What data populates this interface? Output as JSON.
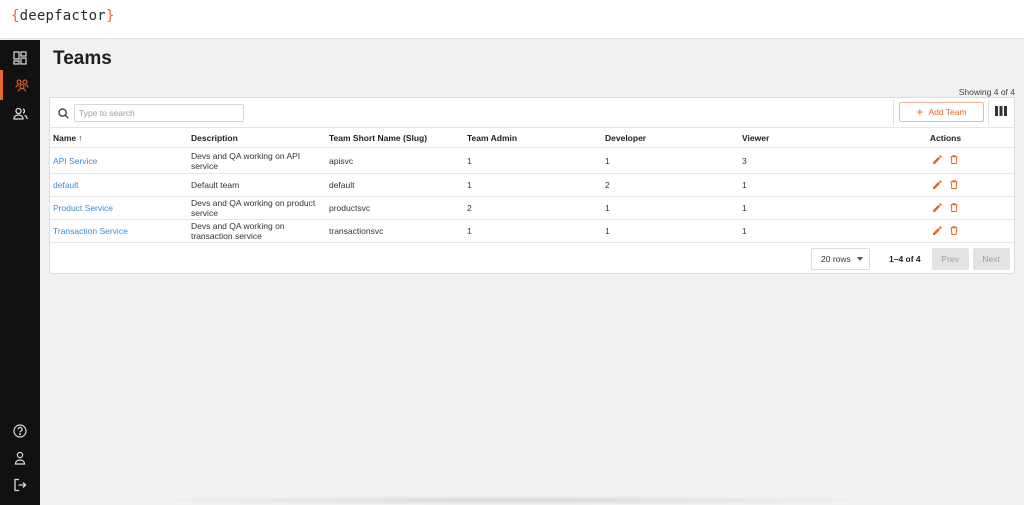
{
  "app": {
    "logo_open": "{",
    "logo_text": "deepfactor",
    "logo_close": "}"
  },
  "colors": {
    "accent": "#e8672c",
    "link": "#3a8bd8",
    "sidebar_bg": "#111111"
  },
  "sidebar": {
    "top_items": [
      {
        "icon": "dashboard-icon",
        "active": false
      },
      {
        "icon": "teams-icon",
        "active": true
      },
      {
        "icon": "users-icon",
        "active": false
      }
    ],
    "bottom_items": [
      {
        "icon": "help-icon"
      },
      {
        "icon": "profile-icon"
      },
      {
        "icon": "logout-icon"
      }
    ]
  },
  "page": {
    "title": "Teams",
    "showing": "Showing 4 of 4"
  },
  "toolbar": {
    "search_placeholder": "Type to search",
    "add_team_label": "Add Team",
    "columns_icon": "columns-icon"
  },
  "table": {
    "headers": {
      "name": "Name",
      "name_sort": "↑",
      "description": "Description",
      "slug": "Team Short Name (Slug)",
      "admin": "Team Admin",
      "developer": "Developer",
      "viewer": "Viewer",
      "actions": "Actions"
    },
    "rows": [
      {
        "name": "API Service",
        "description_1": "Devs and QA working on API",
        "description_2": "service",
        "slug": "apisvc",
        "admin": "1",
        "developer": "1",
        "viewer": "3"
      },
      {
        "name": "default",
        "description_1": "Default team",
        "description_2": "",
        "slug": "default",
        "admin": "1",
        "developer": "2",
        "viewer": "1"
      },
      {
        "name": "Product Service",
        "description_1": "Devs and QA working on product",
        "description_2": "service",
        "slug": "productsvc",
        "admin": "2",
        "developer": "1",
        "viewer": "1"
      },
      {
        "name": "Transaction Service",
        "description_1": "Devs and QA working on",
        "description_2": "transaction service",
        "slug": "transactionsvc",
        "admin": "1",
        "developer": "1",
        "viewer": "1"
      }
    ]
  },
  "pagination": {
    "rows_per_page": "20 rows",
    "range": "1–4 of 4",
    "prev": "Prev",
    "next": "Next"
  }
}
